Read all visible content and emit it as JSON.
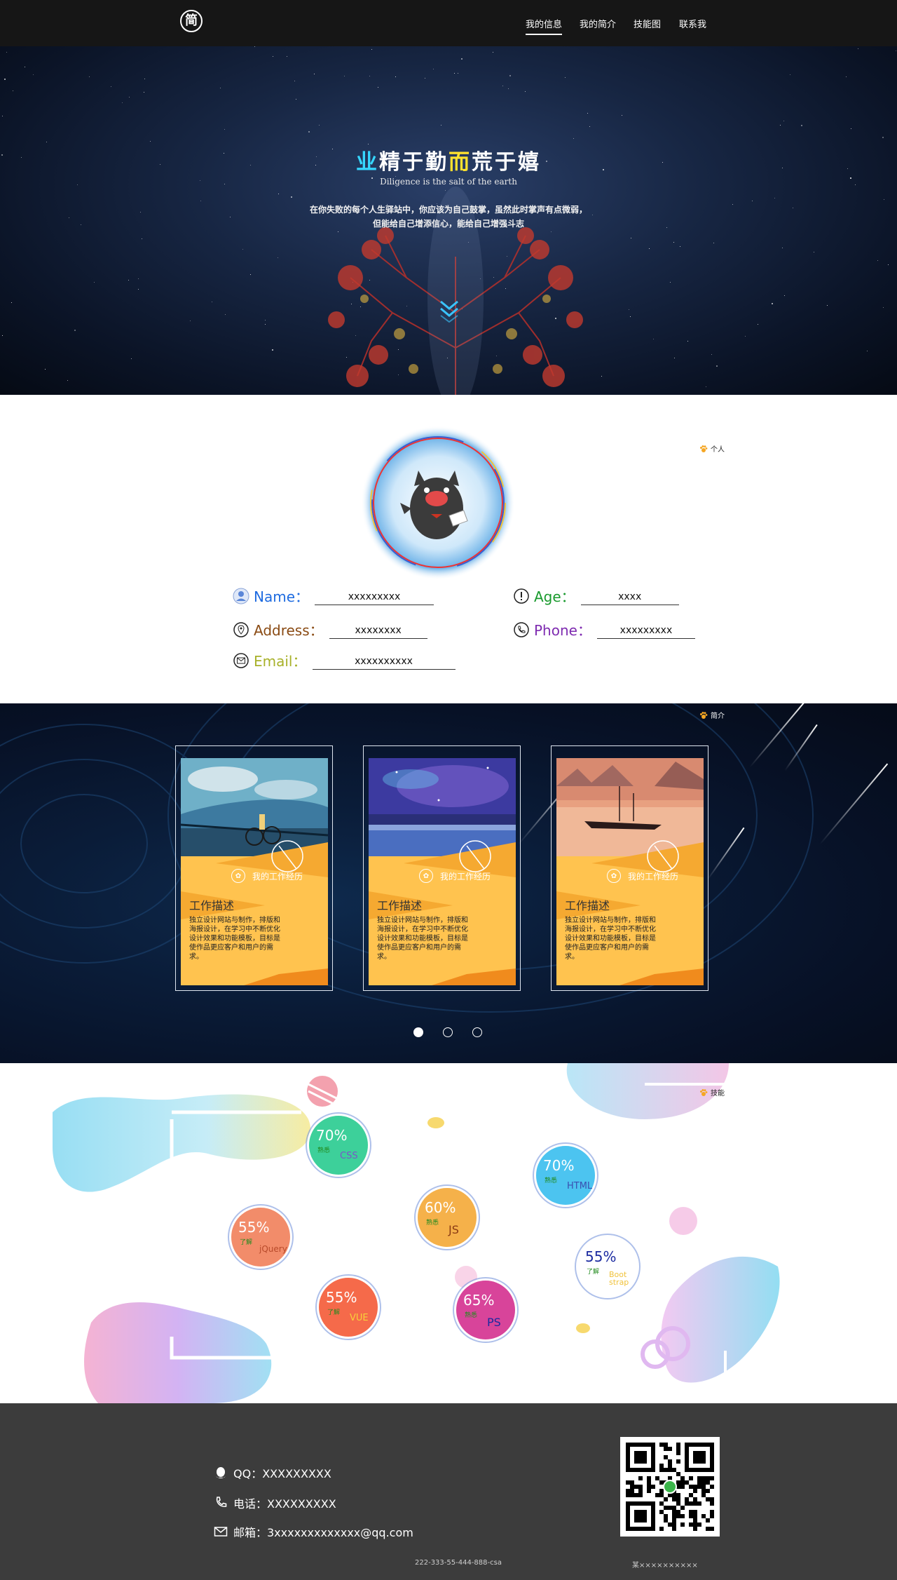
{
  "nav": {
    "logo": "简",
    "items": [
      {
        "label": "我的信息",
        "active": true
      },
      {
        "label": "我的简介",
        "active": false
      },
      {
        "label": "技能图",
        "active": false
      },
      {
        "label": "联系我",
        "active": false
      }
    ]
  },
  "hero": {
    "title_part1": "业",
    "title_part2": "精于勤",
    "title_part3": "而",
    "title_part4": "荒于嬉",
    "subtitle": "Diligence is the salt of the earth",
    "desc_line1": "在你失败的每个人生驿站中，你应该为自己鼓掌，虽然此时掌声有点微弱，",
    "desc_line2": "但能给自己增添信心，能给自己增强斗志"
  },
  "info": {
    "tag": "个人",
    "fields": {
      "name": {
        "label": "Name：",
        "value": "xxxxxxxxx",
        "color": "#1e6be0"
      },
      "age": {
        "label": "Age：",
        "value": "xxxx",
        "color": "#1a9a2e"
      },
      "address": {
        "label": "Address：",
        "value": "xxxxxxxx",
        "color": "#8a4b14"
      },
      "phone": {
        "label": "Phone：",
        "value": "xxxxxxxxx",
        "color": "#7e2bb0"
      },
      "email": {
        "label": "Email：",
        "value": "xxxxxxxxxx",
        "color": "#a8b12a"
      }
    }
  },
  "intro": {
    "tag": "简介",
    "cards": [
      {
        "button": "我的工作经历",
        "title": "工作描述",
        "desc": "独立设计网站与制作，排版和海报设计，在学习中不断优化设计效果和功能模板，目标是使作品更应客户和用户的需求。"
      },
      {
        "button": "我的工作经历",
        "title": "工作描述",
        "desc": "独立设计网站与制作，排版和海报设计，在学习中不断优化设计效果和功能模板，目标是使作品更应客户和用户的需求。"
      },
      {
        "button": "我的工作经历",
        "title": "工作描述",
        "desc": "独立设计网站与制作，排版和海报设计，在学习中不断优化设计效果和功能模板，目标是使作品更应客户和用户的需求。"
      }
    ],
    "active_slide": 1
  },
  "skills": {
    "tag": "技能",
    "items": [
      {
        "name": "CSS",
        "percent": "70%",
        "level": "熟悉",
        "color": "#3dd09a",
        "name_color": "#7a55c8"
      },
      {
        "name": "HTML",
        "percent": "70%",
        "level": "熟悉",
        "color": "#4cc4f0",
        "name_color": "#3a4fb0"
      },
      {
        "name": "JS",
        "percent": "60%",
        "level": "熟悉",
        "color": "#f5b14a",
        "name_color": "#8a3a14"
      },
      {
        "name": "jQuery",
        "percent": "55%",
        "level": "了解",
        "color": "#f28c6a",
        "name_color": "#b84a2a"
      },
      {
        "name": "Boot strap",
        "percent": "55%",
        "level": "了解",
        "color": "#ffffff",
        "name_color": "#f0c23a"
      },
      {
        "name": "VUE",
        "percent": "55%",
        "level": "了解",
        "color": "#f56a4a",
        "name_color": "#f7d23a"
      },
      {
        "name": "PS",
        "percent": "65%",
        "level": "熟悉",
        "color": "#d8449a",
        "name_color": "#1b2aa0"
      }
    ]
  },
  "footer": {
    "qq": "QQ：XXXXXXXXX",
    "phone": "电话：XXXXXXXXX",
    "email": "邮箱：3xxxxxxxxxxxxx@qq.com",
    "note_left": "222-333-55-444-888-csa",
    "note_right": "某××××××××××"
  }
}
